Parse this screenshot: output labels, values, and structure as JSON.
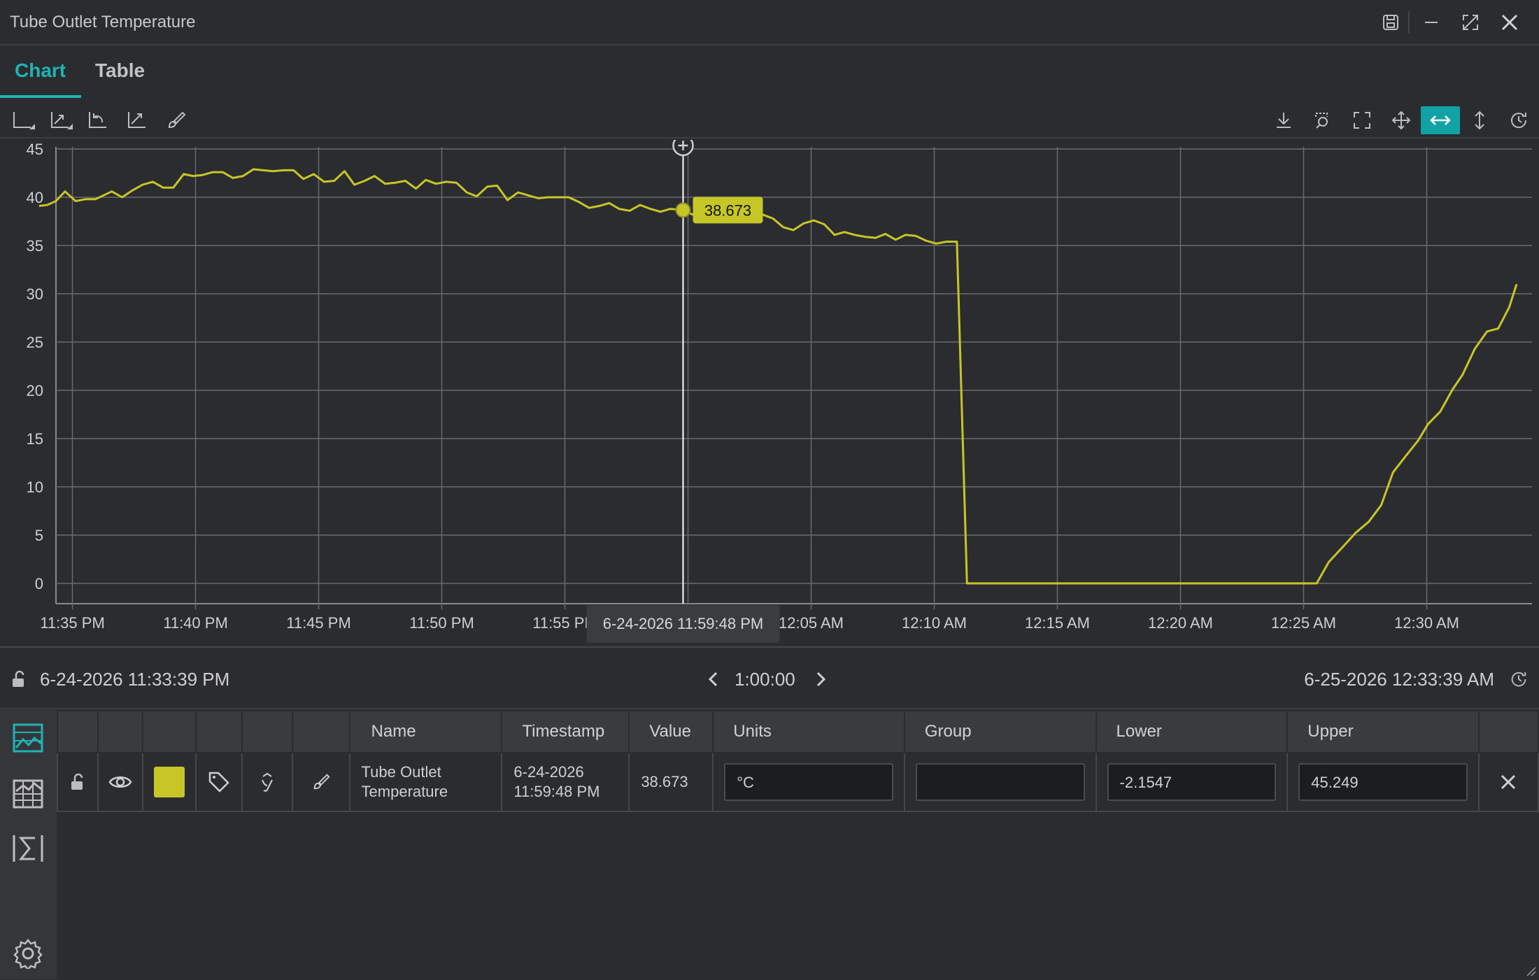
{
  "window": {
    "title": "Tube Outlet Temperature"
  },
  "tabs": [
    {
      "label": "Chart",
      "active": true
    },
    {
      "label": "Table",
      "active": false
    }
  ],
  "colors": {
    "accent": "#1fb3b3",
    "series": "#c6c627",
    "background": "#2b2c2f"
  },
  "toolbar": {
    "left_icons": [
      "x-axis-icon",
      "y-axis-icon",
      "undo-zoom-icon",
      "trend-icon",
      "brush-icon"
    ],
    "right_icons": [
      "download-icon",
      "zoom-select-icon",
      "fullscreen-icon",
      "pan-icon",
      "horizontal-zoom-icon",
      "vertical-zoom-icon",
      "history-icon"
    ],
    "active": "horizontal-zoom-icon"
  },
  "cursor": {
    "value_label": "38.673",
    "time_label": "6-24-2026 11:59:48 PM",
    "time_minutes": 26.15
  },
  "chart_data": {
    "type": "line",
    "title": "",
    "xlabel": "",
    "ylabel": "",
    "ylim": [
      -2.1547,
      45.249
    ],
    "yticks": [
      "0",
      "5",
      "10",
      "15",
      "20",
      "25",
      "30",
      "35",
      "40",
      "45"
    ],
    "xticks": [
      "11:35 PM",
      "11:40 PM",
      "11:45 PM",
      "11:50 PM",
      "11:55 PM",
      "12:00 AM",
      "12:05 AM",
      "12:10 AM",
      "12:15 AM",
      "12:20 AM",
      "12:25 AM",
      "12:30 AM"
    ],
    "x_start": "6-24-2026 11:33:39 PM",
    "x_end": "6-25-2026 12:33:39 AM",
    "grid": true,
    "series": [
      {
        "name": "Tube Outlet Temperature",
        "x_minutes_from_start": [
          0.0,
          0.33,
          0.68,
          1.05,
          1.48,
          1.87,
          2.28,
          2.95,
          3.37,
          3.78,
          4.2,
          4.62,
          5.03,
          5.45,
          5.87,
          6.25,
          6.62,
          7.05,
          7.45,
          7.87,
          8.28,
          8.7,
          9.1,
          9.5,
          9.92,
          10.33,
          10.73,
          11.15,
          11.57,
          11.98,
          12.4,
          12.8,
          13.22,
          13.62,
          14.05,
          14.45,
          14.87,
          15.3,
          15.7,
          16.12,
          16.53,
          16.95,
          17.37,
          17.77,
          18.2,
          18.6,
          19.02,
          19.45,
          19.85,
          20.27,
          20.68,
          21.1,
          21.5,
          21.93,
          22.33,
          22.75,
          23.15,
          23.55,
          23.98,
          24.4,
          24.82,
          25.23,
          25.63,
          26.15,
          26.45,
          26.87,
          27.3,
          27.72,
          28.12,
          28.55,
          28.95,
          29.38,
          29.8,
          30.22,
          30.63,
          31.05,
          31.47,
          31.88,
          32.3,
          32.7,
          33.12,
          33.55,
          33.97,
          34.37,
          34.78,
          35.18,
          35.6,
          36.02,
          36.43,
          36.85,
          37.27,
          37.68,
          38.1,
          38.52,
          38.95,
          39.9,
          40.37,
          49.9,
          50.45,
          50.85,
          51.35,
          51.88,
          52.37,
          52.95,
          53.45,
          54.0,
          54.5,
          54.98,
          55.5,
          56.0,
          56.4,
          56.9,
          57.4,
          57.8,
          58.3,
          58.8,
          59.25,
          59.7,
          60.0
        ],
        "values": [
          39.1,
          39.2,
          39.6,
          40.6,
          39.6,
          39.8,
          39.8,
          40.6,
          40.0,
          40.7,
          41.3,
          41.6,
          41.0,
          41.0,
          42.4,
          42.2,
          42.3,
          42.6,
          42.6,
          42.0,
          42.2,
          42.9,
          42.8,
          42.7,
          42.8,
          42.8,
          41.9,
          42.4,
          41.6,
          41.7,
          42.7,
          41.3,
          41.7,
          42.2,
          41.4,
          41.5,
          41.7,
          40.9,
          41.8,
          41.4,
          41.6,
          41.5,
          40.5,
          40.1,
          41.1,
          41.2,
          39.7,
          40.5,
          40.2,
          39.9,
          40.0,
          40.0,
          40.0,
          39.5,
          38.9,
          39.1,
          39.4,
          38.8,
          38.6,
          39.2,
          38.8,
          38.5,
          38.8,
          38.673,
          38.3,
          37.9,
          38.2,
          37.9,
          37.8,
          38.4,
          38.3,
          38.2,
          37.8,
          36.9,
          36.6,
          37.3,
          37.6,
          37.2,
          36.1,
          36.4,
          36.1,
          35.9,
          35.8,
          36.2,
          35.6,
          36.1,
          36.0,
          35.5,
          35.2,
          35.4,
          35.4,
          0.0,
          0.0,
          0.0,
          0.0,
          0.0,
          0.0,
          0.0,
          0.0,
          0.0,
          0.0,
          0.0,
          2.2,
          3.8,
          5.2,
          6.4,
          8.1,
          11.5,
          13.2,
          14.8,
          16.5,
          17.8,
          20.1,
          21.6,
          24.3,
          26.1,
          26.4,
          28.6,
          31.0,
          31.3
        ]
      }
    ]
  },
  "time_range": {
    "start": "6-24-2026 11:33:39 PM",
    "duration": "1:00:00",
    "end": "6-25-2026 12:33:39 AM"
  },
  "legend_table": {
    "headers": {
      "name": "Name",
      "timestamp": "Timestamp",
      "value": "Value",
      "units": "Units",
      "group": "Group",
      "lower": "Lower",
      "upper": "Upper"
    },
    "row": {
      "name_line1": "Tube Outlet",
      "name_line2": "Temperature",
      "ts_line1": "6-24-2026",
      "ts_line2": "11:59:48 PM",
      "value": "38.673",
      "units": "°C",
      "group": "",
      "lower": "-2.1547",
      "upper": "45.249"
    }
  },
  "sidebar": {
    "icons": [
      "chart-legend-icon",
      "chart-list-icon",
      "formula-icon",
      "settings-icon"
    ]
  }
}
